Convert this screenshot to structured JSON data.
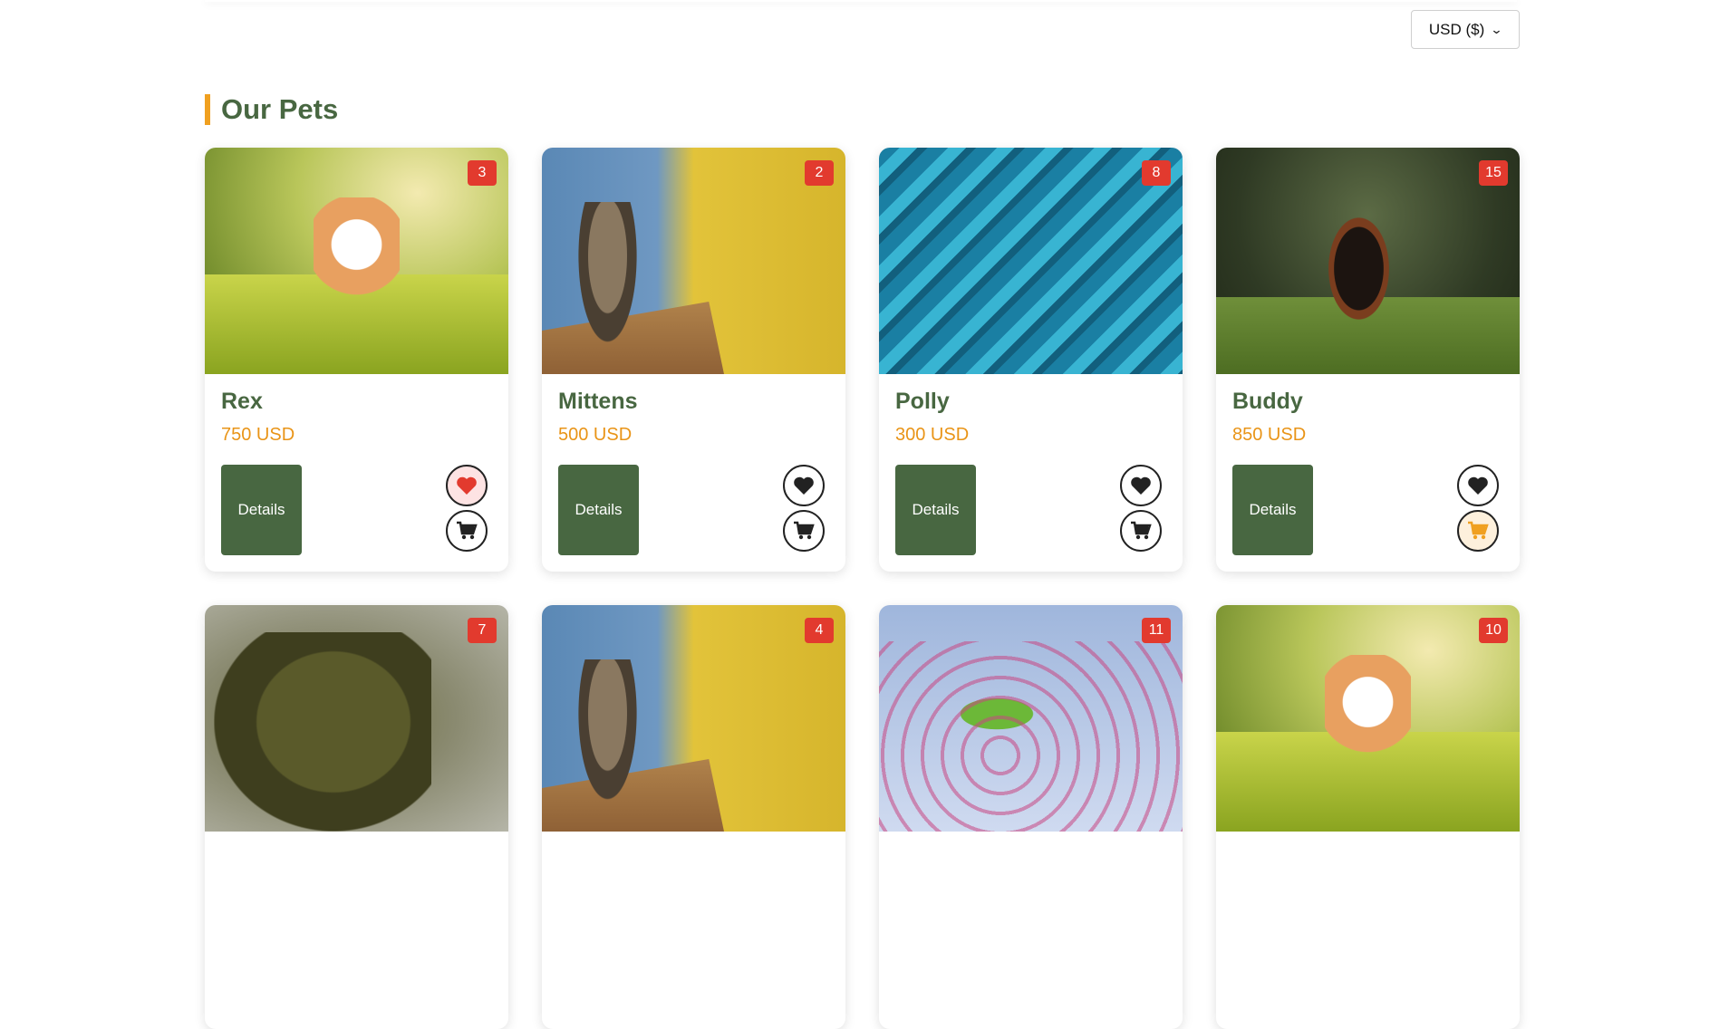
{
  "currency": {
    "selected": "USD ($)"
  },
  "section": {
    "title": "Our Pets"
  },
  "labels": {
    "details": "Details"
  },
  "colors": {
    "primary": "#486741",
    "accent": "#f0a020",
    "price": "#e99417",
    "badge": "#e23a2e"
  },
  "pets": [
    {
      "name": "Rex",
      "price": "750 USD",
      "badge": "3",
      "image": "corgi",
      "favorited": true,
      "in_cart": false
    },
    {
      "name": "Mittens",
      "price": "500 USD",
      "badge": "2",
      "image": "tabby-cat",
      "favorited": false,
      "in_cart": false
    },
    {
      "name": "Polly",
      "price": "300 USD",
      "badge": "8",
      "image": "blue-feathers",
      "favorited": false,
      "in_cart": false
    },
    {
      "name": "Buddy",
      "price": "850 USD",
      "badge": "15",
      "image": "running-puppy",
      "favorited": false,
      "in_cart": true
    },
    {
      "badge": "7",
      "image": "kea-parrots"
    },
    {
      "badge": "4",
      "image": "tabby-cat"
    },
    {
      "badge": "11",
      "image": "green-parakeet-blossom"
    },
    {
      "badge": "10",
      "image": "corgi"
    }
  ]
}
